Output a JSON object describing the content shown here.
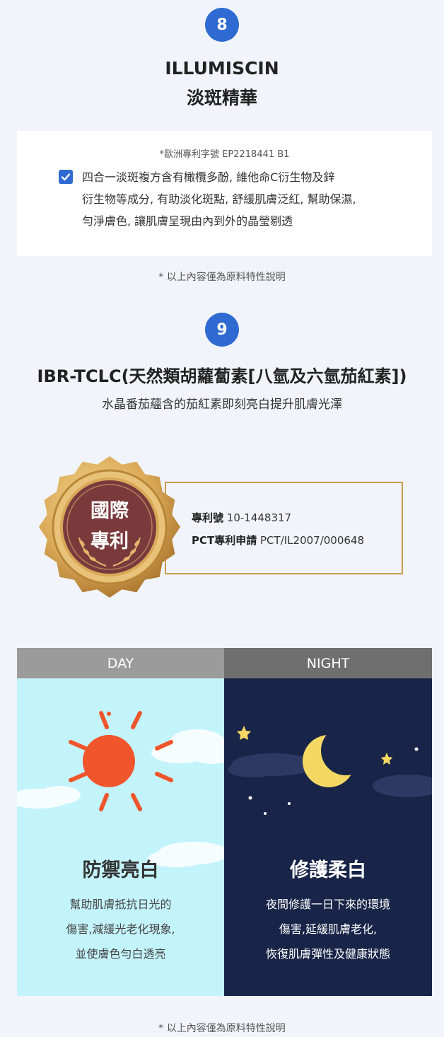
{
  "section8": {
    "number": "8",
    "title_en": "ILLUMISCIN",
    "title_zh": "淡斑精華",
    "patent": "*歐洲專利字號 EP2218441 B1",
    "description_lines": [
      "四合一淡斑複方含有橄欖多酚, 維他命C衍生物及鋅",
      "衍生物等成分, 有助淡化斑點, 舒緩肌膚泛紅, 幫助保濕,",
      "勻淨膚色, 讓肌膚呈現由內到外的晶瑩剔透"
    ],
    "note": "* 以上內容僅為原料特性說明"
  },
  "section9": {
    "number": "9",
    "title": "IBR-TCLC(天然類胡蘿蔔素[八氫及六氫茄紅素])",
    "subtitle": "水晶番茄蘊含的茄紅素即刻亮白提升肌膚光澤",
    "medal_line1": "國際",
    "medal_line2": "專利",
    "patent_no_label": "專利號",
    "patent_no_value": "10-1448317",
    "pct_label": "PCT專利申請",
    "pct_value": "PCT/IL2007/000648"
  },
  "day": {
    "header": "DAY",
    "title": "防禦亮白",
    "lines": [
      "幫助肌膚抵抗日光的",
      "傷害,減緩光老化現象,",
      "並使膚色勻白透亮"
    ]
  },
  "night": {
    "header": "NIGHT",
    "title": "修護柔白",
    "lines": [
      "夜間修護一日下來的環境",
      "傷害,延緩肌膚老化,",
      "恢復肌膚彈性及健康狀態"
    ]
  },
  "bottom_note": "* 以上內容僅為原料特性說明",
  "colors": {
    "accent": "#2f6ad2",
    "gold": "#c89a4e",
    "day_sky": "#c4f4fb",
    "night_sky": "#192548",
    "header_day": "#9b9b9b",
    "header_night": "#6f6f6f",
    "sun": "#f0552b",
    "moon": "#f5d864"
  },
  "icons": [
    "check-icon",
    "medal-icon",
    "sun-icon",
    "moon-icon",
    "star-icon",
    "cloud-icon"
  ]
}
